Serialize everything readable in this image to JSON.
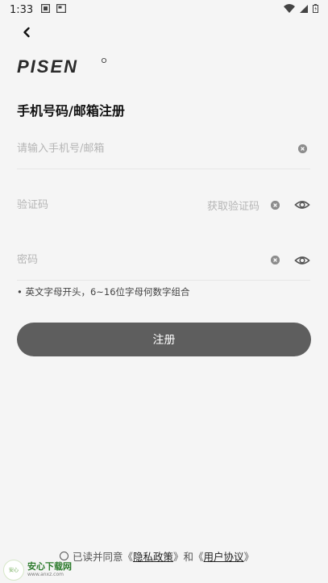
{
  "status_bar": {
    "time": "1:33"
  },
  "header": {
    "back_icon": "chevron-left-icon",
    "logo_text": "PISEN"
  },
  "page": {
    "title": "手机号码/邮箱注册"
  },
  "form": {
    "account_placeholder": "请输入手机号/邮箱",
    "code_placeholder": "验证码",
    "get_code_label": "获取验证码",
    "password_placeholder": "密码",
    "password_hint": "• 英文字母开头，6~16位字母何数字组合",
    "submit_label": "注册"
  },
  "agreement": {
    "prefix": "已读并同意《",
    "privacy_link": "隐私政策",
    "middle": "》和《",
    "terms_link": "用户协议",
    "suffix": "》"
  },
  "watermark": {
    "badge": "安心",
    "title": "安心下载网",
    "url": "www.anxz.com"
  },
  "colors": {
    "background": "#f5f5f5",
    "button": "#5e5e5e",
    "placeholder": "#b5b5b5"
  }
}
